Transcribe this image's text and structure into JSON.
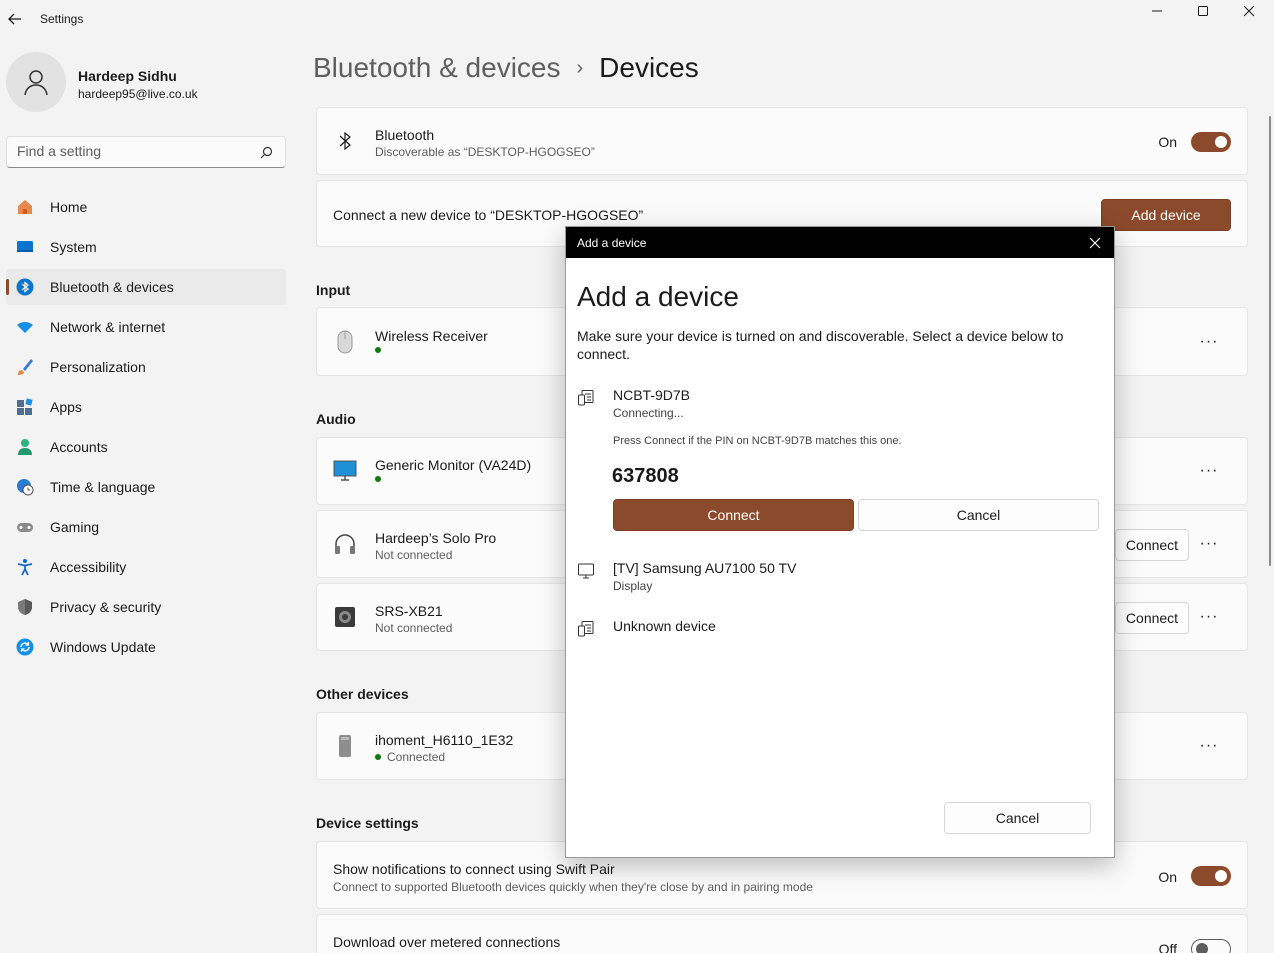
{
  "window": {
    "title": "Settings"
  },
  "profile": {
    "name": "Hardeep Sidhu",
    "email": "hardeep95@live.co.uk"
  },
  "search": {
    "placeholder": "Find a setting"
  },
  "nav": {
    "items": [
      {
        "label": "Home",
        "icon": "home-icon",
        "color": "#e27a3f"
      },
      {
        "label": "System",
        "icon": "system-icon",
        "color": "#0078d4"
      },
      {
        "label": "Bluetooth & devices",
        "icon": "bluetooth-icon",
        "color": "#0078d4",
        "active": true
      },
      {
        "label": "Network & internet",
        "icon": "wifi-icon",
        "color": "#0a84d8"
      },
      {
        "label": "Personalization",
        "icon": "brush-icon",
        "color": "#e27a3f"
      },
      {
        "label": "Apps",
        "icon": "apps-icon",
        "color": "#3b6fa8"
      },
      {
        "label": "Accounts",
        "icon": "person-icon",
        "color": "#1faa7b"
      },
      {
        "label": "Time & language",
        "icon": "globe-clock-icon",
        "color": "#2a7ad6"
      },
      {
        "label": "Gaming",
        "icon": "gamepad-icon",
        "color": "#7a7a7a"
      },
      {
        "label": "Accessibility",
        "icon": "accessibility-icon",
        "color": "#1668c4"
      },
      {
        "label": "Privacy & security",
        "icon": "shield-icon",
        "color": "#6b6b6b"
      },
      {
        "label": "Windows Update",
        "icon": "update-icon",
        "color": "#0a84d8"
      }
    ]
  },
  "breadcrumb": {
    "parent": "Bluetooth & devices",
    "separator": "›",
    "current": "Devices"
  },
  "bluetooth": {
    "title": "Bluetooth",
    "subtitle": "Discoverable as “DESKTOP-HGOGSEO”",
    "state": "On"
  },
  "add_device_card": {
    "text": "Connect a new device to “DESKTOP-HGOGSEO”",
    "button": "Add device"
  },
  "sections": {
    "input": "Input",
    "audio": "Audio",
    "other": "Other devices",
    "device_settings": "Device settings"
  },
  "input_devices": [
    {
      "name": "Wireless Receiver"
    }
  ],
  "audio_devices": [
    {
      "name": "Generic Monitor (VA24D)",
      "status": ""
    },
    {
      "name": "Hardeep’s Solo Pro",
      "status": "Not connected",
      "button": "Connect"
    },
    {
      "name": "SRS-XB21",
      "status": "Not connected",
      "button": "Connect"
    }
  ],
  "other_devices": [
    {
      "name": "ihoment_H6110_1E32",
      "status": "Connected"
    }
  ],
  "device_settings": {
    "swift_pair": {
      "title": "Show notifications to connect using Swift Pair",
      "subtitle": "Connect to supported Bluetooth devices quickly when they're close by and in pairing mode",
      "state": "On"
    },
    "metered": {
      "title": "Download over metered connections",
      "state": "Off"
    }
  },
  "more_glyph": "···",
  "dialog": {
    "bar_title": "Add a device",
    "heading": "Add a device",
    "intro": "Make sure your device is turned on and discoverable. Select a device below to connect.",
    "devices": [
      {
        "name": "NCBT-9D7B",
        "status": "Connecting..."
      },
      {
        "name": "[TV] Samsung AU7100 50 TV",
        "status": "Display"
      },
      {
        "name": "Unknown device",
        "status": ""
      }
    ],
    "pin_prompt": "Press Connect if the PIN on NCBT-9D7B matches this one.",
    "pin": "637808",
    "connect_button": "Connect",
    "cancel_inline": "Cancel",
    "cancel_footer": "Cancel"
  },
  "colors": {
    "accent": "#8b4a2b",
    "status_green": "#0f7b0f"
  }
}
